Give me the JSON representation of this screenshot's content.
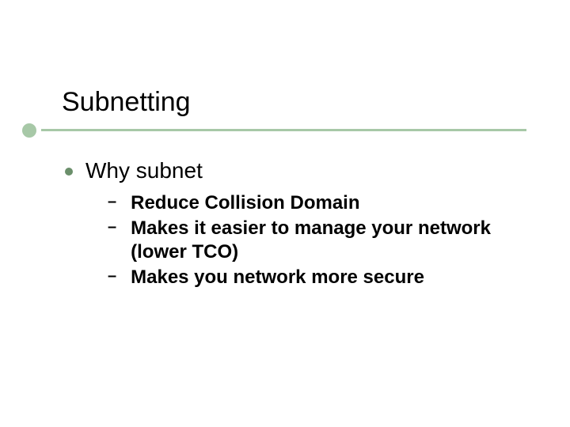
{
  "title": "Subnetting",
  "l1": "Why subnet",
  "sub": [
    "Reduce Collision Domain",
    "Makes it easier to manage your network (lower TCO)",
    "Makes you network more secure"
  ]
}
